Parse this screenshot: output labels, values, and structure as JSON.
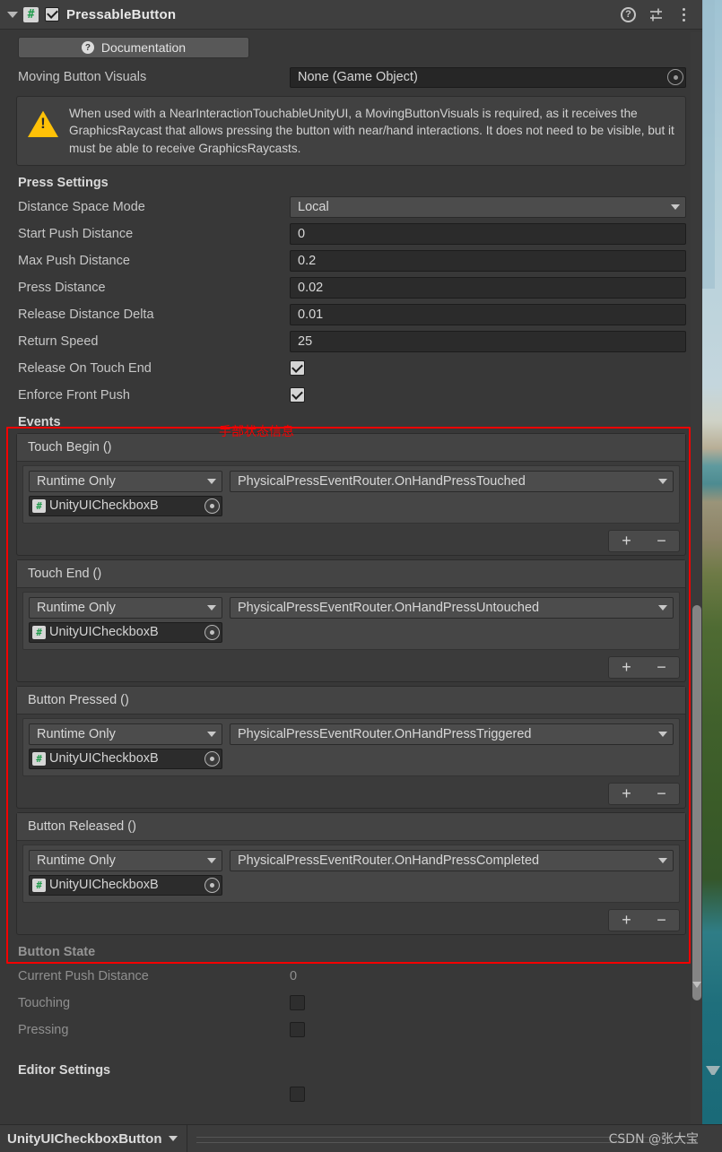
{
  "header": {
    "title": "PressableButton",
    "enabled_checkbox": true,
    "script_icon": "#",
    "help_icon": "?",
    "icons": [
      "help-icon",
      "preset-icon",
      "more-menu-icon"
    ]
  },
  "documentation": {
    "label": "Documentation",
    "icon": "?"
  },
  "moving_button_visuals": {
    "label": "Moving Button Visuals",
    "value": "None (Game Object)"
  },
  "warning": {
    "icon": "warning-triangle-icon",
    "text": "When used with a NearInteractionTouchableUnityUI, a MovingButtonVisuals is required, as it receives the GraphicsRaycast that allows pressing the button with near/hand interactions.  It does not need to be visible, but it must be able to receive GraphicsRaycasts."
  },
  "press_settings": {
    "title": "Press Settings",
    "fields": [
      {
        "label": "Distance Space Mode",
        "value": "Local",
        "type": "popup"
      },
      {
        "label": "Start Push Distance",
        "value": "0",
        "type": "text"
      },
      {
        "label": "Max Push Distance",
        "value": "0.2",
        "type": "text"
      },
      {
        "label": "Press Distance",
        "value": "0.02",
        "type": "text"
      },
      {
        "label": "Release Distance Delta",
        "value": "0.01",
        "type": "text"
      },
      {
        "label": "Return Speed",
        "value": "25",
        "type": "text"
      },
      {
        "label": "Release On Touch End",
        "value": "",
        "type": "checkbox",
        "checked": true
      },
      {
        "label": "Enforce Front Push",
        "value": "",
        "type": "checkbox",
        "checked": true
      }
    ]
  },
  "events": {
    "title": "Events",
    "add_label": "+",
    "remove_label": "−",
    "blocks": [
      {
        "title": "Touch Begin ()",
        "mode": "Runtime Only",
        "function": "PhysicalPressEventRouter.OnHandPressTouched",
        "object": "UnityUICheckboxB"
      },
      {
        "title": "Touch End ()",
        "mode": "Runtime Only",
        "function": "PhysicalPressEventRouter.OnHandPressUntouched",
        "object": "UnityUICheckboxB"
      },
      {
        "title": "Button Pressed ()",
        "mode": "Runtime Only",
        "function": "PhysicalPressEventRouter.OnHandPressTriggered",
        "object": "UnityUICheckboxB"
      },
      {
        "title": "Button Released ()",
        "mode": "Runtime Only",
        "function": "PhysicalPressEventRouter.OnHandPressCompleted",
        "object": "UnityUICheckboxB"
      }
    ]
  },
  "annotation": {
    "text": "手部状态信息",
    "color": "#f40000"
  },
  "button_state": {
    "title": "Button State",
    "fields": [
      {
        "label": "Current Push Distance",
        "value": "0",
        "type": "readonly"
      },
      {
        "label": "Touching",
        "value": "",
        "type": "checkbox",
        "checked": false
      },
      {
        "label": "Pressing",
        "value": "",
        "type": "checkbox",
        "checked": false
      }
    ]
  },
  "editor_settings": {
    "title": "Editor Settings"
  },
  "footer": {
    "breadcrumb": "UnityUICheckboxButton",
    "watermark": "CSDN @张大宝"
  }
}
